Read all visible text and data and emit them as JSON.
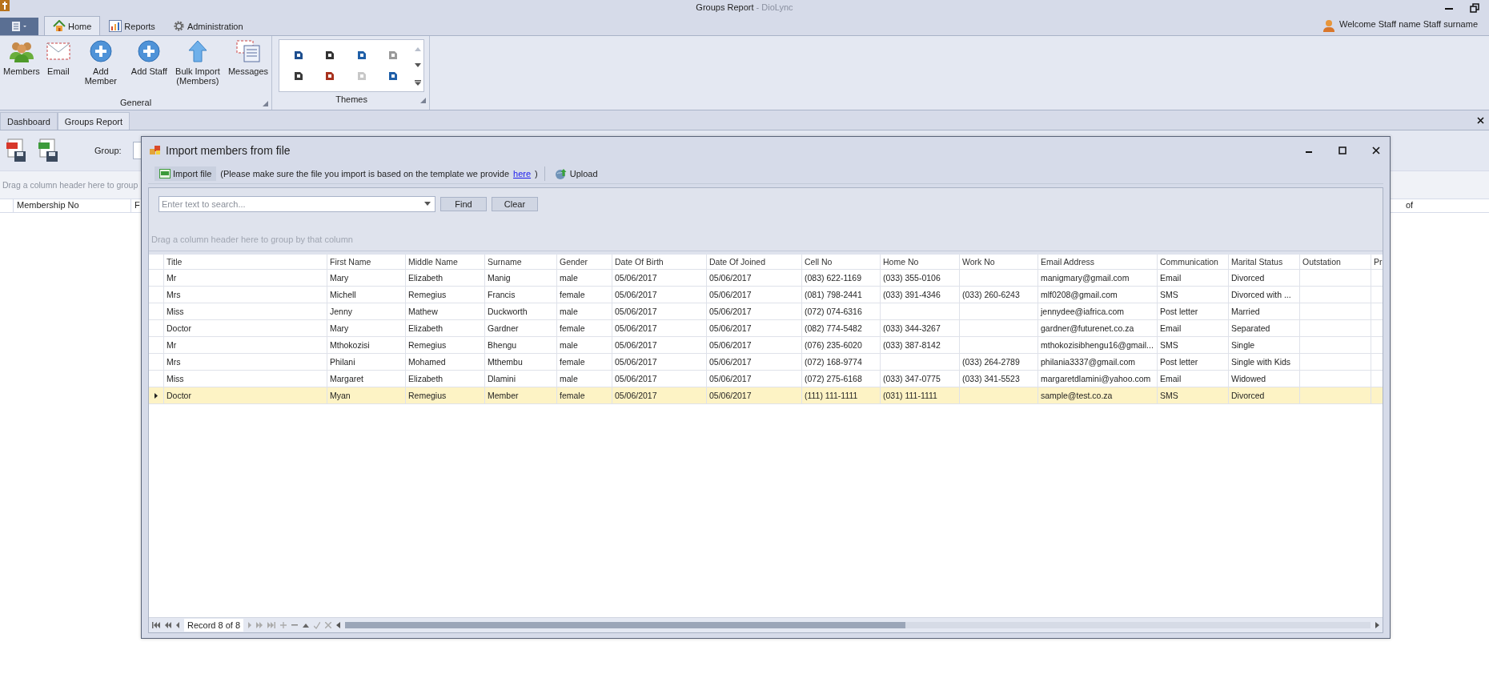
{
  "window": {
    "title": "Groups Report",
    "title_suffix": "- DioLync"
  },
  "ribbon": {
    "tabs": [
      {
        "label": "Home",
        "kind": "home",
        "selected": true
      },
      {
        "label": "Reports",
        "kind": "chart",
        "selected": false
      },
      {
        "label": "Administration",
        "kind": "gear",
        "selected": false
      }
    ],
    "user": "Welcome Staff name Staff surname",
    "general": {
      "label": "General",
      "buttons": [
        {
          "label": "Members",
          "kind": "people"
        },
        {
          "label": "Email",
          "kind": "mail"
        },
        {
          "label": "Add Member",
          "kind": "add"
        },
        {
          "label": "Add Staff",
          "kind": "add"
        },
        {
          "label": "Bulk Import (Members)",
          "kind": "upload"
        },
        {
          "label": "Messages",
          "kind": "messages"
        }
      ]
    },
    "themes": {
      "label": "Themes"
    }
  },
  "document_tabs": [
    {
      "label": "Dashboard",
      "selected": false
    },
    {
      "label": "Groups Report",
      "selected": true
    }
  ],
  "report": {
    "group_label": "Group:",
    "group_panel_hint": "Drag a column header here to group",
    "columns": [
      "Membership No",
      "F",
      "of"
    ]
  },
  "dialog": {
    "title": "Import members from file",
    "toolbar": {
      "import_button": "Import file",
      "note": "(Please make sure the file you import is based on the template we provide",
      "link": "here",
      "note_end": ")",
      "upload_button": "Upload"
    },
    "search": {
      "placeholder": "Enter text to search...",
      "find": "Find",
      "clear": "Clear"
    },
    "group_panel_hint": "Drag a column header here to group by that column",
    "grid": {
      "columns": [
        "Title",
        "First Name",
        "Middle Name",
        "Surname",
        "Gender",
        "Date Of Birth",
        "Date Of Joined",
        "Cell No",
        "Home No",
        "Work No",
        "Email Address",
        "Communication",
        "Marital Status",
        "Outstation",
        "Pr"
      ],
      "rows": [
        {
          "selected": false,
          "cells": [
            "Mr",
            "Mary",
            "Elizabeth",
            "Manig",
            "male",
            "05/06/2017",
            "05/06/2017",
            "(083) 622-1169",
            "(033) 355-0106",
            null,
            "manigmary@gmail.com",
            "Email",
            "Divorced",
            null,
            null
          ]
        },
        {
          "selected": false,
          "cells": [
            "Mrs",
            "Michell",
            "Remegius",
            "Francis",
            "female",
            "05/06/2017",
            "05/06/2017",
            "(081) 798-2441",
            "(033) 391-4346",
            "(033) 260-6243",
            "mlf0208@gmail.com",
            "SMS",
            "Divorced with ...",
            null,
            null
          ]
        },
        {
          "selected": false,
          "cells": [
            "Miss",
            "Jenny",
            "Mathew",
            "Duckworth",
            "male",
            "05/06/2017",
            "05/06/2017",
            "(072) 074-6316",
            null,
            null,
            "jennydee@iafrica.com",
            "Post letter",
            "Married",
            null,
            null
          ]
        },
        {
          "selected": false,
          "cells": [
            "Doctor",
            "Mary",
            "Elizabeth",
            "Gardner",
            "female",
            "05/06/2017",
            "05/06/2017",
            "(082) 774-5482",
            "(033) 344-3267",
            null,
            "gardner@futurenet.co.za",
            "Email",
            "Separated",
            null,
            null
          ]
        },
        {
          "selected": false,
          "cells": [
            "Mr",
            "Mthokozisi",
            "Remegius",
            "Bhengu",
            "male",
            "05/06/2017",
            "05/06/2017",
            "(076) 235-6020",
            "(033) 387-8142",
            null,
            "mthokozisibhengu16@gmail...",
            "SMS",
            "Single",
            null,
            null
          ]
        },
        {
          "selected": false,
          "cells": [
            "Mrs",
            "Philani",
            "Mohamed",
            "Mthembu",
            "female",
            "05/06/2017",
            "05/06/2017",
            "(072) 168-9774",
            null,
            "(033) 264-2789",
            "philania3337@gmail.com",
            "Post letter",
            "Single with Kids",
            null,
            null
          ]
        },
        {
          "selected": false,
          "cells": [
            "Miss",
            "Margaret",
            "Elizabeth",
            "Dlamini",
            "male",
            "05/06/2017",
            "05/06/2017",
            "(072) 275-6168",
            "(033) 347-0775",
            "(033) 341-5523",
            "margaretdlamini@yahoo.com",
            "Email",
            "Widowed",
            null,
            null
          ]
        },
        {
          "selected": true,
          "cells": [
            "Doctor",
            "Myan",
            "Remegius",
            "Member",
            "female",
            "05/06/2017",
            "05/06/2017",
            "(111) 111-1111",
            "(031) 111-1111",
            null,
            "sample@test.co.za",
            "SMS",
            "Divorced",
            null,
            null
          ]
        }
      ]
    },
    "navigator": {
      "record": "Record 8 of 8"
    }
  }
}
